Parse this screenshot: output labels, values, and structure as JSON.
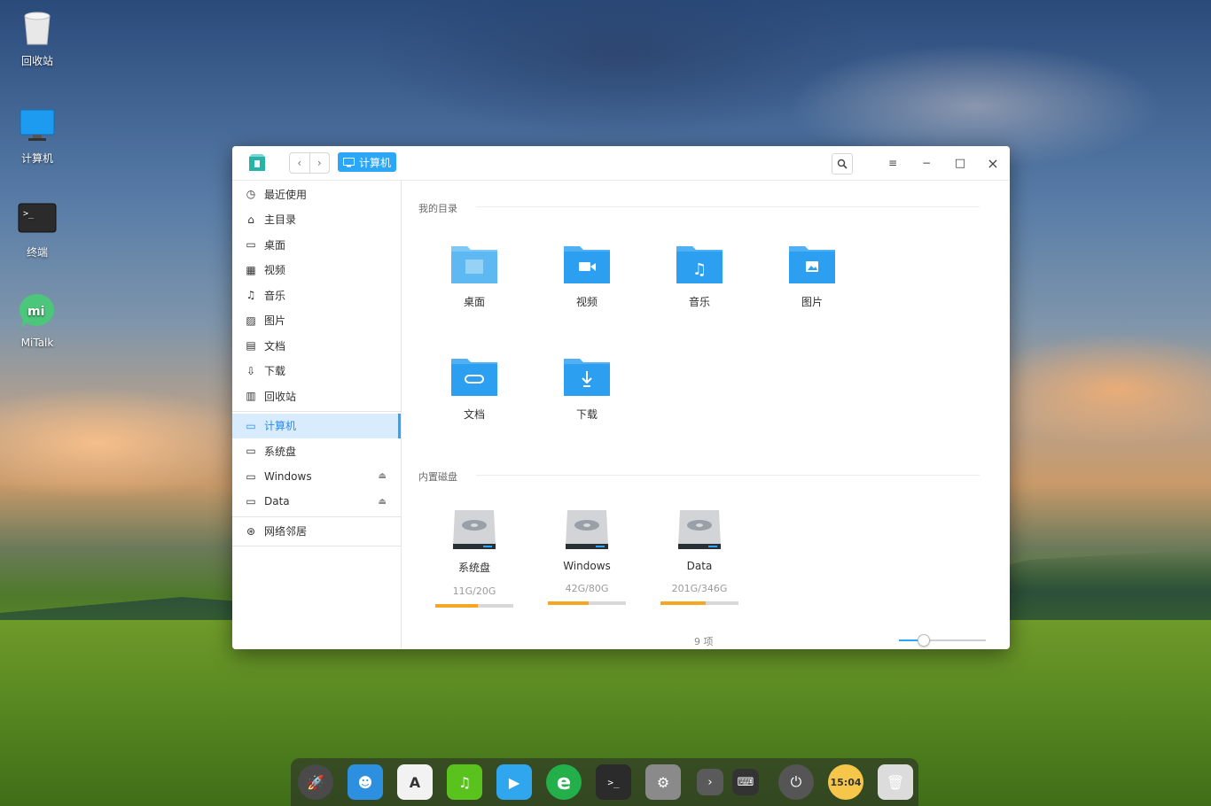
{
  "desktop": {
    "icons": [
      {
        "label": "回收站",
        "icon": "trash-icon"
      },
      {
        "label": "计算机",
        "icon": "computer-icon"
      },
      {
        "label": "终端",
        "icon": "terminal-icon"
      },
      {
        "label": "MiTalk",
        "icon": "mitalk-icon"
      }
    ]
  },
  "window": {
    "breadcrumb": "计算机",
    "buttons": {
      "back": "‹",
      "forward": "›",
      "search": "⚲",
      "menu": "≡",
      "minimize": "−",
      "maximize": "□",
      "close": "×"
    }
  },
  "sidebar": {
    "items": [
      {
        "label": "最近使用",
        "icon": "clock-icon",
        "glyph": "◷"
      },
      {
        "label": "主目录",
        "icon": "home-icon",
        "glyph": "⌂"
      },
      {
        "label": "桌面",
        "icon": "desktop-icon",
        "glyph": "▭"
      },
      {
        "label": "视频",
        "icon": "video-icon",
        "glyph": "▦"
      },
      {
        "label": "音乐",
        "icon": "music-icon",
        "glyph": "♫"
      },
      {
        "label": "图片",
        "icon": "picture-icon",
        "glyph": "▨"
      },
      {
        "label": "文档",
        "icon": "document-icon",
        "glyph": "▤"
      },
      {
        "label": "下载",
        "icon": "download-icon",
        "glyph": "⇩"
      },
      {
        "label": "回收站",
        "icon": "trash-icon",
        "glyph": "▥"
      }
    ],
    "devices": [
      {
        "label": "计算机",
        "icon": "computer-icon",
        "glyph": "▭",
        "active": true
      },
      {
        "label": "系统盘",
        "icon": "disk-icon",
        "glyph": "▭"
      },
      {
        "label": "Windows",
        "icon": "disk-icon",
        "glyph": "▭",
        "eject": "⏏"
      },
      {
        "label": "Data",
        "icon": "disk-icon",
        "glyph": "▭",
        "eject": "⏏"
      }
    ],
    "network": {
      "label": "网络邻居",
      "icon": "network-icon",
      "glyph": "⊛"
    }
  },
  "main": {
    "my_dirs_title": "我的目录",
    "folders": [
      {
        "label": "桌面",
        "icon": "desktop-folder-icon",
        "glyph": "▣"
      },
      {
        "label": "视频",
        "icon": "video-folder-icon",
        "glyph": "▶"
      },
      {
        "label": "音乐",
        "icon": "music-folder-icon",
        "glyph": "♫"
      },
      {
        "label": "图片",
        "icon": "picture-folder-icon",
        "glyph": "▲"
      },
      {
        "label": "文档",
        "icon": "document-folder-icon",
        "glyph": "⊂"
      },
      {
        "label": "下载",
        "icon": "download-folder-icon",
        "glyph": "⇣"
      }
    ],
    "disks_title": "内置磁盘",
    "disks": [
      {
        "label": "系统盘",
        "usage": "11G/20G",
        "fraction": 0.55
      },
      {
        "label": "Windows",
        "usage": "42G/80G",
        "fraction": 0.525
      },
      {
        "label": "Data",
        "usage": "201G/346G",
        "fraction": 0.58
      }
    ],
    "status": {
      "count": "9 项",
      "zoom": 0.28
    }
  },
  "dock": {
    "items": [
      {
        "icon": "launcher-icon",
        "color": "#4a4a4a"
      },
      {
        "icon": "file-manager-icon",
        "color": "#2c8fe0"
      },
      {
        "icon": "app-store-icon",
        "color": "#f2f2f2"
      },
      {
        "icon": "music-player-icon",
        "color": "#5ac21c"
      },
      {
        "icon": "video-player-icon",
        "color": "#2fa6ee"
      },
      {
        "icon": "browser-icon",
        "color": "#23b04a"
      },
      {
        "icon": "terminal-icon",
        "color": "#2b2b2b"
      },
      {
        "icon": "settings-icon",
        "color": "#8a8a8a"
      },
      {
        "icon": "expand-tray-icon",
        "color": "#5a5a5a"
      },
      {
        "icon": "keyboard-icon",
        "color": "#333333"
      },
      {
        "icon": "power-icon",
        "color": "#555555"
      },
      {
        "icon": "clock-icon",
        "color": "#f6c64a",
        "text": "15:04"
      },
      {
        "icon": "trash-icon",
        "color": "#dcdcdc"
      }
    ]
  }
}
